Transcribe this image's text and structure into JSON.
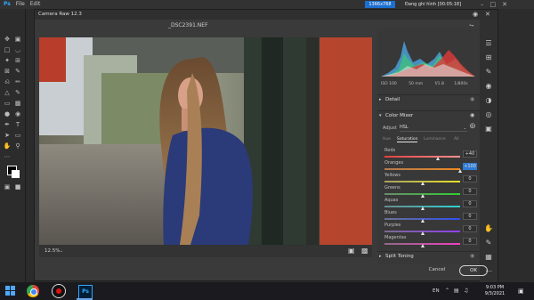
{
  "ps_menu": [
    "Ps",
    "File",
    "Edit"
  ],
  "ps_header": {
    "size": "1366x768",
    "recording": "Đang ghi hình [00:05:18]"
  },
  "dialog": {
    "app_title": "Camera Raw 12.3",
    "filename": "_DSC2391.NEF",
    "zoom": "12.5%",
    "camera_info": [
      "ISO 100",
      "50 mm",
      "f/1.8",
      "1/800s"
    ],
    "sections": {
      "detail": "Detail",
      "color_mixer": "Color Mixer",
      "split_toning": "Split Toning"
    },
    "adjust_label": "Adjust",
    "adjust_value": "HSL",
    "tabs": [
      "Hue",
      "Saturation",
      "Luminance",
      "All"
    ],
    "active_tab": "Saturation",
    "sliders": [
      {
        "label": "Reds",
        "value": "+40",
        "pos": 0.7,
        "colors": [
          "#e04040",
          "#ff9090"
        ]
      },
      {
        "label": "Oranges",
        "value": "+100",
        "pos": 1.0,
        "colors": [
          "#b07a50",
          "#f08a20"
        ]
      },
      {
        "label": "Yellows",
        "value": "0",
        "pos": 0.5,
        "colors": [
          "#a8a060",
          "#e6e02a"
        ]
      },
      {
        "label": "Greens",
        "value": "0",
        "pos": 0.5,
        "colors": [
          "#6a8a6a",
          "#30d030"
        ]
      },
      {
        "label": "Aquas",
        "value": "0",
        "pos": 0.5,
        "colors": [
          "#6a8a90",
          "#30d0d0"
        ]
      },
      {
        "label": "Blues",
        "value": "0",
        "pos": 0.5,
        "colors": [
          "#6a7090",
          "#3050f0"
        ]
      },
      {
        "label": "Purples",
        "value": "0",
        "pos": 0.5,
        "colors": [
          "#7a6a90",
          "#9040f0"
        ]
      },
      {
        "label": "Magentas",
        "value": "0",
        "pos": 0.5,
        "colors": [
          "#906a88",
          "#f040c0"
        ]
      }
    ],
    "cancel": "Cancel",
    "ok": "OK"
  },
  "taskbar": {
    "lang": "EN",
    "time": "9:03 PM",
    "date": "9/3/2021"
  },
  "colors": {
    "accent": "#2f7bd5",
    "panel": "#383838"
  }
}
